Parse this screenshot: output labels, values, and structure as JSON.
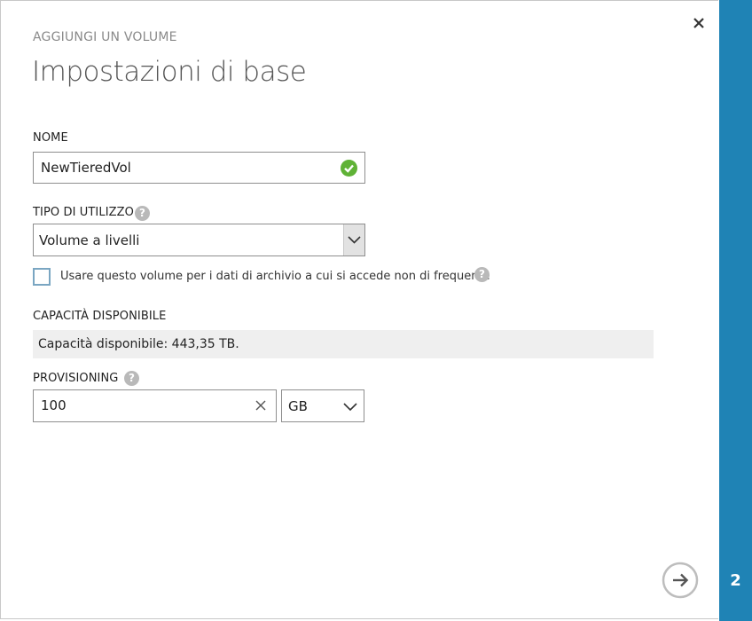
{
  "dialog": {
    "subtitle": "AGGIUNGI UN VOLUME",
    "title": "Impostazioni di base"
  },
  "fields": {
    "name": {
      "label": "NOME",
      "value": "NewTieredVol",
      "status_icon": "check-circle-icon"
    },
    "usage_type": {
      "label": "TIPO DI UTILIZZO",
      "help_icon": "help-icon",
      "selected": "Volume a livelli"
    },
    "archive_checkbox": {
      "label": "Usare questo volume per i dati di archivio a cui si accede non di frequente",
      "checked": false,
      "help_icon": "help-icon"
    },
    "capacity": {
      "label": "CAPACITÀ DISPONIBILE",
      "text": "Capacità disponibile: 443,35 TB."
    },
    "provisioning": {
      "label": "PROVISIONING",
      "help_icon": "help-icon",
      "value": "100",
      "unit": "GB"
    }
  },
  "help_glyph": "?",
  "step": {
    "number": "2"
  },
  "colors": {
    "accent": "#1f83b5",
    "success": "#5fb236",
    "help": "#b9b9b9"
  }
}
